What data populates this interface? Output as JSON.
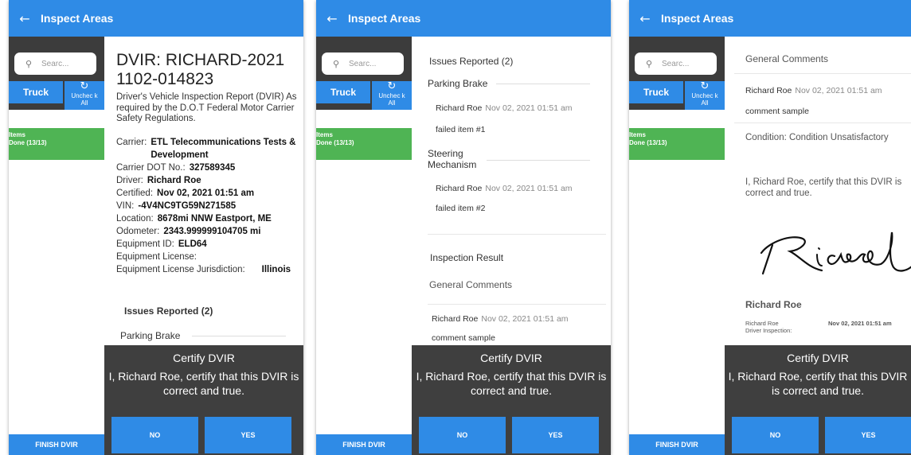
{
  "app": {
    "title": "Inspect Areas",
    "back_icon": "arrow-left-icon",
    "search_placeholder": "Searc...",
    "truck_tab": "Truck",
    "uncheck_all": "Unchec k All",
    "items_label": "Items",
    "items_done": "Done (13/13)",
    "finish": "FINISH DVIR"
  },
  "certify": {
    "title": "Certify DVIR",
    "message": "I, Richard Roe, certify that this DVIR is correct and true.",
    "no": "NO",
    "yes": "YES"
  },
  "screen1": {
    "title": "DVIR: RICHARD-2021 1102-014823",
    "description": "Driver's Vehicle Inspection Report (DVIR) As required by the D.O.T Federal Motor Carrier Safety Regulations.",
    "fields": [
      {
        "label": "Carrier:",
        "value": "ETL Telecommunications Tests & Development"
      },
      {
        "label": "Carrier DOT No.:",
        "value": "327589345"
      },
      {
        "label": "Driver:",
        "value": "Richard Roe"
      },
      {
        "label": "Certified:",
        "value": "Nov 02, 2021  01:51 am"
      },
      {
        "label": "VIN:",
        "value": "-4V4NC9TG59N271585"
      },
      {
        "label": "Location:",
        "value": "8678mi NNW Eastport, ME"
      },
      {
        "label": "Odometer:",
        "value": "2343.999999104705 mi"
      },
      {
        "label": "Equipment ID:",
        "value": "ELD64"
      },
      {
        "label": "Equipment License:",
        "value": ""
      },
      {
        "label": "Equipment License Jurisdiction:",
        "value": "Illinois"
      }
    ],
    "issues_reported": "Issues Reported (2)",
    "first_issue": "Parking Brake"
  },
  "screen2": {
    "issues_reported": "Issues Reported (2)",
    "issues": [
      {
        "name": "Parking Brake",
        "author": "Richard Roe",
        "date": "Nov 02, 2021  01:51 am",
        "comment": "failed item #1"
      },
      {
        "name": "Steering Mechanism",
        "author": "Richard Roe",
        "date": "Nov 02, 2021  01:51 am",
        "comment": "failed item #2"
      }
    ],
    "inspection_result": "Inspection Result",
    "general_comments": "General Comments",
    "gc_author": "Richard Roe",
    "gc_date": "Nov 02, 2021  01:51 am",
    "gc_comment": "comment sample"
  },
  "screen3": {
    "general_comments": "General Comments",
    "gc_author": "Richard Roe",
    "gc_date": "Nov 02, 2021  01:51 am",
    "gc_comment": "comment sample",
    "condition": "Condition: Condition Unsatisfactory",
    "certify_text": "I, Richard Roe, certify that this DVIR is correct and true.",
    "signer_name": "Richard Roe",
    "small_name": "Richard Roe",
    "small_role": "Driver Inspection:",
    "small_date": "Nov 02, 2021  01:51 am"
  },
  "colors": {
    "appbar": "#2f8be6",
    "sidebar_dark": "#3c3c3c",
    "items_done": "#4fb454",
    "certify_bg": "#3f3f3f"
  }
}
